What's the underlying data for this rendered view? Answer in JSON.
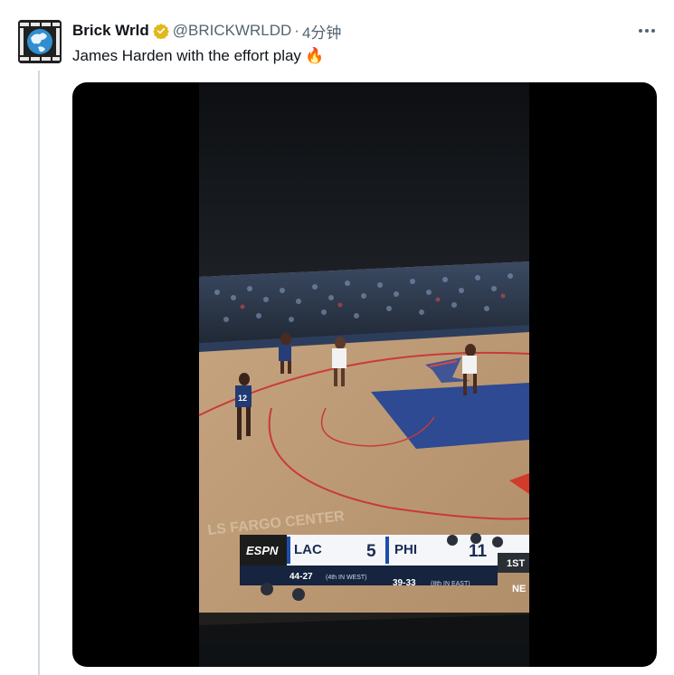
{
  "tweet": {
    "author_name": "Brick Wrld",
    "author_handle": "@BRICKWRLDD",
    "separator": "·",
    "timestamp": "4分钟",
    "text": "James Harden with the effort play",
    "emoji": "🔥",
    "more_icon": "more-horizontal-icon",
    "verified_color": "#e2b719"
  },
  "video": {
    "network": "ESPN",
    "away_team": "LAC",
    "away_score": "5",
    "away_record": "44-27",
    "away_standing": "(4th IN WEST)",
    "home_team": "PHI",
    "home_score": "11",
    "home_record": "39-33",
    "home_standing": "(8th IN EAST)",
    "quarter": "1ST",
    "corner_tag": "NE",
    "player_number": "12",
    "arena_text": "LS FARGO CENTER"
  }
}
